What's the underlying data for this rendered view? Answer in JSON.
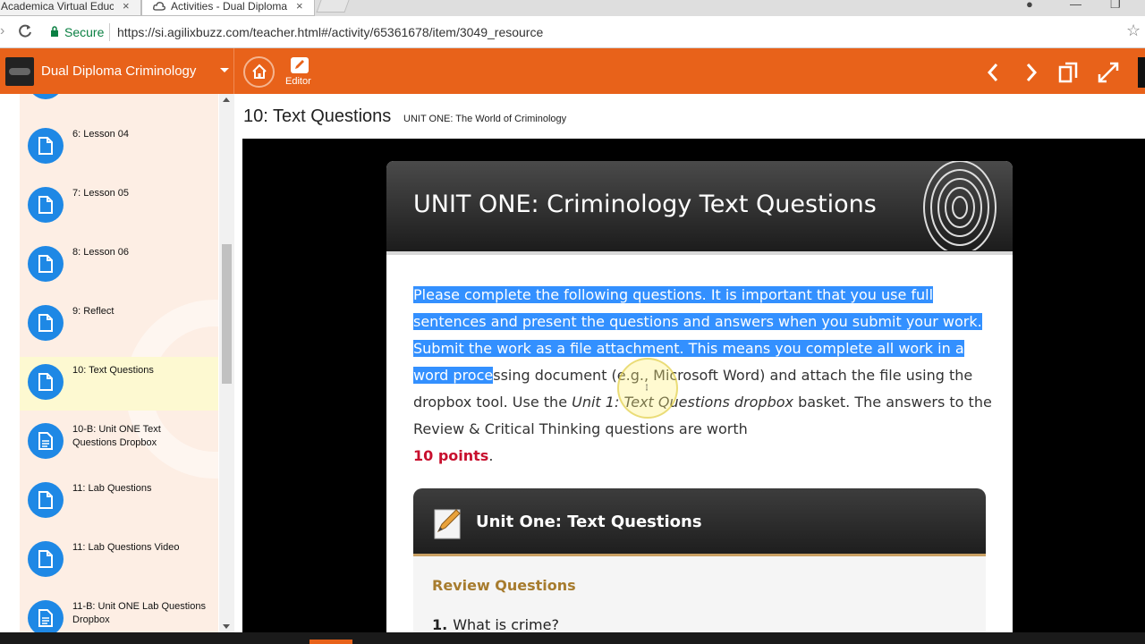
{
  "browser": {
    "tabs": [
      {
        "label": "Academica Virtual Educa",
        "close": "×"
      },
      {
        "label": "Activities - Dual Diploma",
        "close": "×"
      }
    ],
    "secure_label": "Secure",
    "url": "https://si.agilixbuzz.com/teacher.html#/activity/65361678/item/3049_resource",
    "window_controls": {
      "user": "●",
      "minimize": "—",
      "maximize": "❐"
    }
  },
  "app_header": {
    "course_title": "Dual Diploma Criminology",
    "editor_label": "Editor",
    "colors": {
      "brand": "#e8621a"
    }
  },
  "sidebar": {
    "items": [
      {
        "label": "6: Lesson 04",
        "icon": "document-icon",
        "active": false
      },
      {
        "label": "7: Lesson 05",
        "icon": "document-icon",
        "active": false
      },
      {
        "label": "8: Lesson 06",
        "icon": "document-icon",
        "active": false
      },
      {
        "label": "9: Reflect",
        "icon": "document-icon",
        "active": false
      },
      {
        "label": "10: Text Questions",
        "icon": "document-icon",
        "active": true
      },
      {
        "label": "10-B: Unit ONE Text Questions Dropbox",
        "icon": "dropbox-icon",
        "active": false
      },
      {
        "label": "11: Lab Questions",
        "icon": "document-icon",
        "active": false
      },
      {
        "label": "11: Lab Questions Video",
        "icon": "document-icon",
        "active": false
      },
      {
        "label": "11-B: Unit ONE Lab Questions Dropbox",
        "icon": "dropbox-icon",
        "active": false
      }
    ]
  },
  "main": {
    "title": "10: Text Questions",
    "subtitle": "UNIT ONE: The World of Criminology",
    "card": {
      "heading": "UNIT ONE: Criminology Text Questions",
      "para_selected_1": "Please complete the following questions. It is important that you use full sentences and present the questions and answers when you submit your work. Submit the work as a file attachment. This means you complete all work in a word proce",
      "para_rest_1": "ssing document (e.g., Microsoft Word) and attach the file using the dropbox tool. Use the ",
      "para_italic": "Unit 1: Text Questions dropbox",
      "para_rest_2": " basket. The answers to the Review & Critical Thinking questions are worth",
      "points": "10 points",
      "points_suffix": ".",
      "sub_card": {
        "title": "Unit One: Text Questions",
        "section": "Review Questions",
        "question_number": "1.",
        "question_text": "What is crime?"
      }
    }
  }
}
